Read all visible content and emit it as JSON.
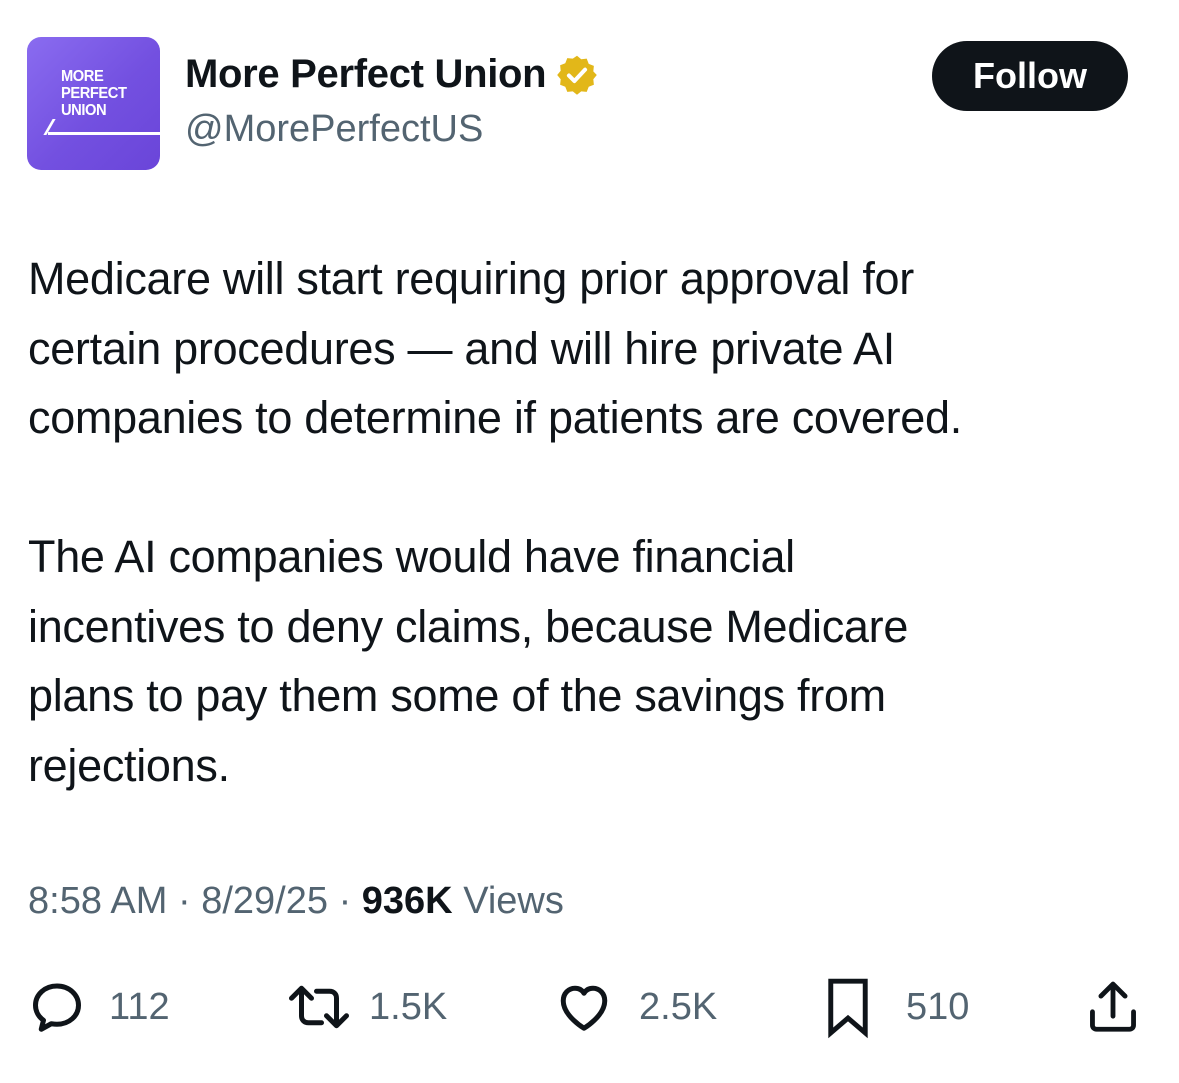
{
  "account": {
    "avatar_text_lines": [
      "MORE",
      "PERFECT",
      "UNION"
    ],
    "display_name": "More Perfect Union",
    "handle": "@MorePerfectUS",
    "verified_icon": "verified-badge-icon",
    "verified_color": "#e2b719",
    "avatar_color": "#7350e0"
  },
  "follow_button": {
    "label": "Follow"
  },
  "tweet": {
    "paragraph_1": "Medicare will start requiring prior approval for\ncertain procedures — and will hire private AI\ncompanies to determine if patients are covered.",
    "paragraph_2": "The AI companies would have financial\nincentives to deny claims, because Medicare\nplans to pay them some of the savings from\nrejections."
  },
  "meta": {
    "time": "8:58 AM",
    "separator": "·",
    "date": "8/29/25",
    "views_count": "936K",
    "views_label": "Views"
  },
  "actions": {
    "reply": {
      "icon": "reply-icon",
      "count": "112"
    },
    "repost": {
      "icon": "repost-icon",
      "count": "1.5K"
    },
    "like": {
      "icon": "heart-icon",
      "count": "2.5K"
    },
    "bookmark": {
      "icon": "bookmark-icon",
      "count": "510"
    },
    "share": {
      "icon": "share-icon"
    }
  }
}
